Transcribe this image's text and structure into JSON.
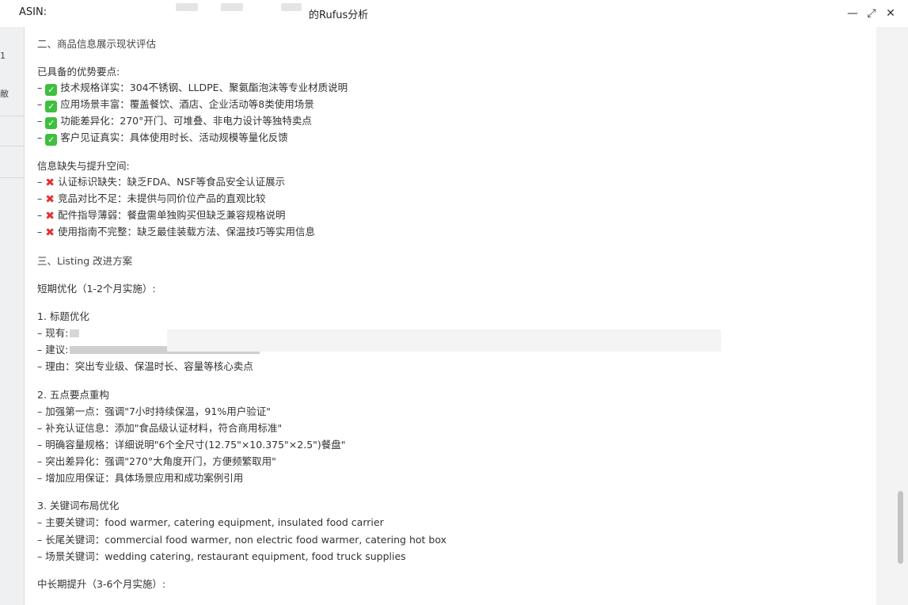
{
  "window": {
    "asin_label": "ASIN:",
    "title": "的Rufus分析",
    "minimize": "—",
    "maximize": "⤢",
    "close": "✕"
  },
  "left_strip": {
    "fragments": [
      "1",
      "敝"
    ]
  },
  "content": {
    "section2_title": "二、商品信息展示现状评估",
    "strengths_title": "已具备的优势要点:",
    "strengths": [
      "技术规格详实：304不锈钢、LLDPE、聚氨酯泡沫等专业材质说明",
      "应用场景丰富：覆盖餐饮、酒店、企业活动等8类使用场景",
      "功能差异化：270°开门、可堆叠、非电力设计等独特卖点",
      "客户见证真实：具体使用时长、活动规模等量化反馈"
    ],
    "gaps_title": "信息缺失与提升空间:",
    "gaps": [
      "认证标识缺失：缺乏FDA、NSF等食品安全认证展示",
      "竞品对比不足：未提供与同价位产品的直观比较",
      "配件指导薄弱：餐盘需单独购买但缺乏兼容规格说明",
      "使用指南不完整：缺乏最佳装载方法、保温技巧等实用信息"
    ],
    "section3_title": "三、Listing 改进方案",
    "short_term_title": "短期优化（1-2个月实施）:",
    "item1_title": "1. 标题优化",
    "item1_current": "– 现有:",
    "item1_suggest": "– 建议:",
    "item1_reason": "– 理由：突出专业级、保温时长、容量等核心卖点",
    "item2_title": "2. 五点要点重构",
    "item2_lines": [
      "– 加强第一点：强调\"7小时持续保温，91%用户验证\"",
      "– 补充认证信息：添加\"食品级认证材料，符合商用标准\"",
      "– 明确容量规格：详细说明\"6个全尺寸(12.75\"×10.375\"×2.5\")餐盘\"",
      "– 突出差异化：强调\"270°大角度开门，方便频繁取用\"",
      "– 增加应用保证：具体场景应用和成功案例引用"
    ],
    "item3_title": "3. 关键词布局优化",
    "item3_lines": [
      "– 主要关键词：food warmer, catering equipment, insulated food carrier",
      "– 长尾关键词：commercial food warmer, non electric food warmer, catering hot box",
      "– 场景关键词：wedding catering, restaurant equipment, food truck supplies"
    ],
    "mid_term_title": "中长期提升（3-6个月实施）:"
  },
  "colors": {
    "check": "#3fbf3f",
    "cross": "#e03232",
    "text": "#333333"
  }
}
